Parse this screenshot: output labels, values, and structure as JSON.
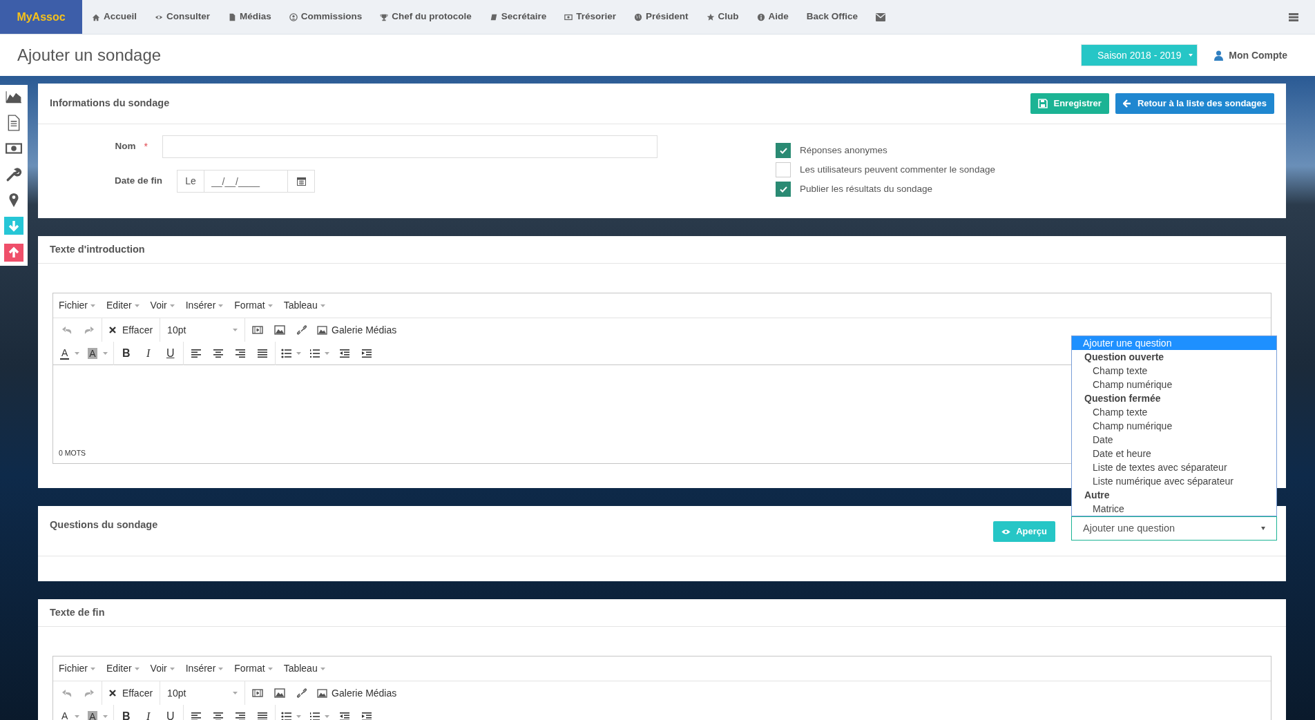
{
  "nav": {
    "brand": "MyAssoc",
    "items": [
      {
        "label": "Accueil"
      },
      {
        "label": "Consulter"
      },
      {
        "label": "Médias"
      },
      {
        "label": "Commissions"
      },
      {
        "label": "Chef du protocole"
      },
      {
        "label": "Secrétaire"
      },
      {
        "label": "Trésorier"
      },
      {
        "label": "Président"
      },
      {
        "label": "Club"
      },
      {
        "label": "Aide"
      },
      {
        "label": "Back Office"
      }
    ]
  },
  "header": {
    "title": "Ajouter un sondage",
    "season": "Saison 2018 - 2019",
    "account": "Mon Compte"
  },
  "info_panel": {
    "title": "Informations du sondage",
    "buttons": [
      {
        "label": "Enregistrer",
        "kind": "save"
      },
      {
        "label": "Retour à la liste des sondages",
        "kind": "back"
      }
    ],
    "name_label": "Nom",
    "required_mark": "*",
    "date_label": "Date de fin",
    "date_prefix": "Le",
    "date_placeholder": "__/__/____",
    "options": [
      {
        "label": "Réponses anonymes",
        "checked": true
      },
      {
        "label": "Les utilisateurs peuvent commenter le sondage",
        "checked": false
      },
      {
        "label": "Publier les résultats du sondage",
        "checked": true
      }
    ]
  },
  "intro_panel": {
    "title": "Texte d'introduction",
    "editor": {
      "menus": [
        "Fichier",
        "Editer",
        "Voir",
        "Insérer",
        "Format",
        "Tableau"
      ],
      "clear": "Effacer",
      "font_size": "10pt",
      "gallery": "Galerie Médias",
      "color_glyphs": [
        "A",
        "A"
      ],
      "format_glyphs": [
        "B",
        "I",
        "U"
      ],
      "word_count": "0 MOTS"
    }
  },
  "questions_panel": {
    "title": "Questions du sondage",
    "preview": "Aperçu",
    "select_value": "Ajouter une question",
    "dropdown": [
      {
        "label": "Ajouter une question",
        "kind": "placeholder",
        "selected": true
      },
      {
        "label": "Question ouverte",
        "kind": "group",
        "selected": false
      },
      {
        "label": "Champ texte",
        "kind": "option",
        "selected": false
      },
      {
        "label": "Champ numérique",
        "kind": "option",
        "selected": false
      },
      {
        "label": "Question fermée",
        "kind": "group",
        "selected": false
      },
      {
        "label": "Champ texte",
        "kind": "option",
        "selected": false
      },
      {
        "label": "Champ numérique",
        "kind": "option",
        "selected": false
      },
      {
        "label": "Date",
        "kind": "option",
        "selected": false
      },
      {
        "label": "Date et heure",
        "kind": "option",
        "selected": false
      },
      {
        "label": "Liste de textes avec séparateur",
        "kind": "option",
        "selected": false
      },
      {
        "label": "Liste numérique avec séparateur",
        "kind": "option",
        "selected": false
      },
      {
        "label": "Autre",
        "kind": "group",
        "selected": false
      },
      {
        "label": "Matrice",
        "kind": "option",
        "selected": false
      }
    ]
  },
  "end_panel": {
    "title": "Texte de fin",
    "editor": {
      "menus": [
        "Fichier",
        "Editer",
        "Voir",
        "Insérer",
        "Format",
        "Tableau"
      ],
      "clear": "Effacer",
      "font_size": "10pt",
      "gallery": "Galerie Médias",
      "color_glyphs": [
        "A",
        "A"
      ],
      "format_glyphs": [
        "B",
        "I",
        "U"
      ]
    }
  }
}
